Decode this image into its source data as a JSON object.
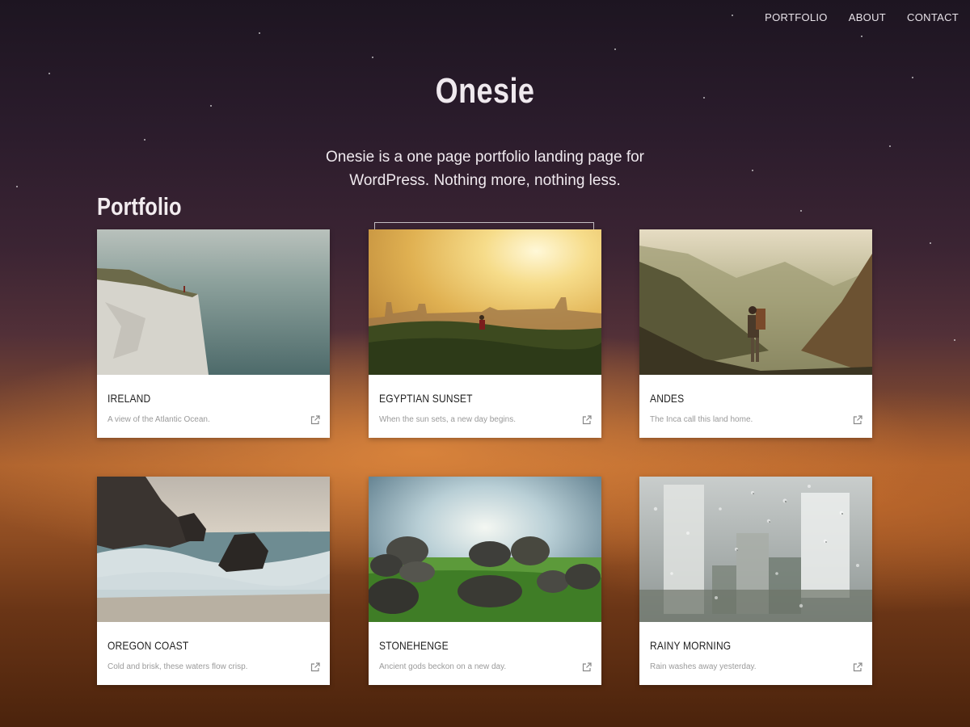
{
  "nav": {
    "items": [
      {
        "label": "PORTFOLIO"
      },
      {
        "label": "ABOUT"
      },
      {
        "label": "CONTACT"
      }
    ]
  },
  "hero": {
    "title": "Onesie",
    "tagline": "Onesie is a one page portfolio landing page for WordPress. Nothing more, nothing less."
  },
  "portfolio": {
    "heading": "Portfolio",
    "items": [
      {
        "title": "IRELAND",
        "description": "A view of the Atlantic Ocean.",
        "image": "sea-cliff-photo"
      },
      {
        "title": "EGYPTIAN SUNSET",
        "description": "When the sun sets, a new day begins.",
        "image": "sunset-city-photo"
      },
      {
        "title": "ANDES",
        "description": "The Inca call this land home.",
        "image": "mountain-hiker-photo"
      },
      {
        "title": "OREGON COAST",
        "description": "Cold and brisk, these waters flow crisp.",
        "image": "rocky-coast-photo"
      },
      {
        "title": "STONEHENGE",
        "description": "Ancient gods beckon on a new day.",
        "image": "standing-stones-photo"
      },
      {
        "title": "RAINY MORNING",
        "description": "Rain washes away yesterday.",
        "image": "rainy-window-photo"
      }
    ]
  },
  "icons": {
    "external_link": "external-link-icon"
  }
}
